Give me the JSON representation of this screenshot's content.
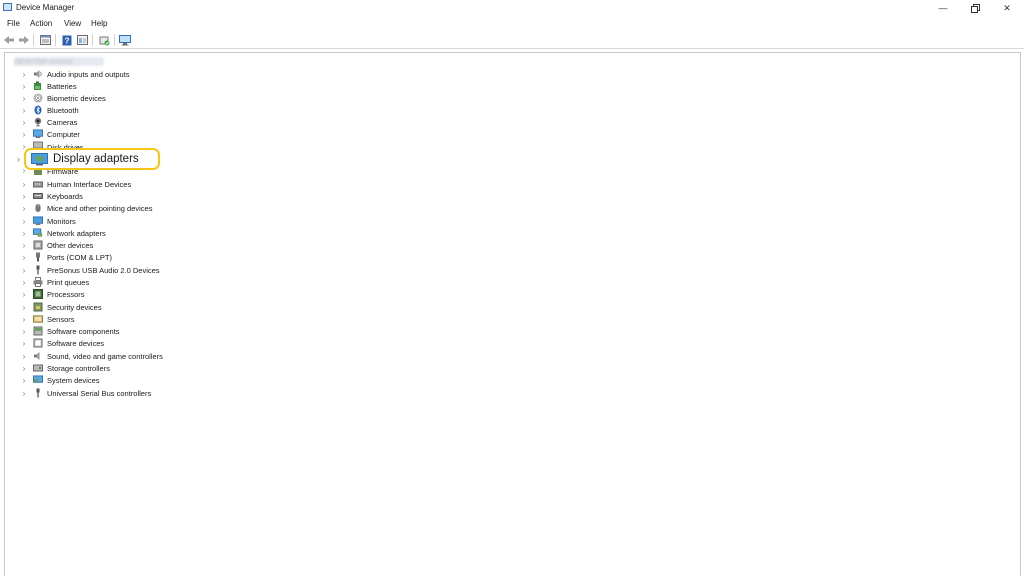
{
  "window": {
    "title": "Device Manager"
  },
  "menu": [
    "File",
    "Action",
    "View",
    "Help"
  ],
  "toolbar": [
    "back-icon",
    "forward-icon",
    "properties-icon",
    "help-icon",
    "show-hidden-icon",
    "update-driver-icon",
    "scan-hardware-icon"
  ],
  "tree": {
    "root_label": "DESKTOP-XXXXX",
    "categories": [
      {
        "label": "Audio inputs and outputs",
        "icon": "speaker-icon"
      },
      {
        "label": "Batteries",
        "icon": "battery-icon"
      },
      {
        "label": "Biometric devices",
        "icon": "fingerprint-icon"
      },
      {
        "label": "Bluetooth",
        "icon": "bluetooth-icon"
      },
      {
        "label": "Cameras",
        "icon": "camera-icon"
      },
      {
        "label": "Computer",
        "icon": "computer-icon"
      },
      {
        "label": "Disk drives",
        "icon": "disk-icon"
      },
      {
        "label": "Display adapters",
        "icon": "display-adapter-icon"
      },
      {
        "label": "Firmware",
        "icon": "firmware-icon"
      },
      {
        "label": "Human Interface Devices",
        "icon": "hid-icon"
      },
      {
        "label": "Keyboards",
        "icon": "keyboard-icon"
      },
      {
        "label": "Mice and other pointing devices",
        "icon": "mouse-icon"
      },
      {
        "label": "Monitors",
        "icon": "monitor-icon"
      },
      {
        "label": "Network adapters",
        "icon": "network-icon"
      },
      {
        "label": "Other devices",
        "icon": "other-device-icon"
      },
      {
        "label": "Ports (COM & LPT)",
        "icon": "port-icon"
      },
      {
        "label": "PreSonus USB Audio 2.0 Devices",
        "icon": "usb-audio-icon"
      },
      {
        "label": "Print queues",
        "icon": "printer-icon"
      },
      {
        "label": "Processors",
        "icon": "processor-icon"
      },
      {
        "label": "Security devices",
        "icon": "security-icon"
      },
      {
        "label": "Sensors",
        "icon": "sensor-icon"
      },
      {
        "label": "Software components",
        "icon": "software-component-icon"
      },
      {
        "label": "Software devices",
        "icon": "software-device-icon"
      },
      {
        "label": "Sound, video and game controllers",
        "icon": "sound-icon"
      },
      {
        "label": "Storage controllers",
        "icon": "storage-icon"
      },
      {
        "label": "System devices",
        "icon": "system-icon"
      },
      {
        "label": "Universal Serial Bus controllers",
        "icon": "usb-icon"
      }
    ]
  },
  "highlight_color": "#f5c518"
}
